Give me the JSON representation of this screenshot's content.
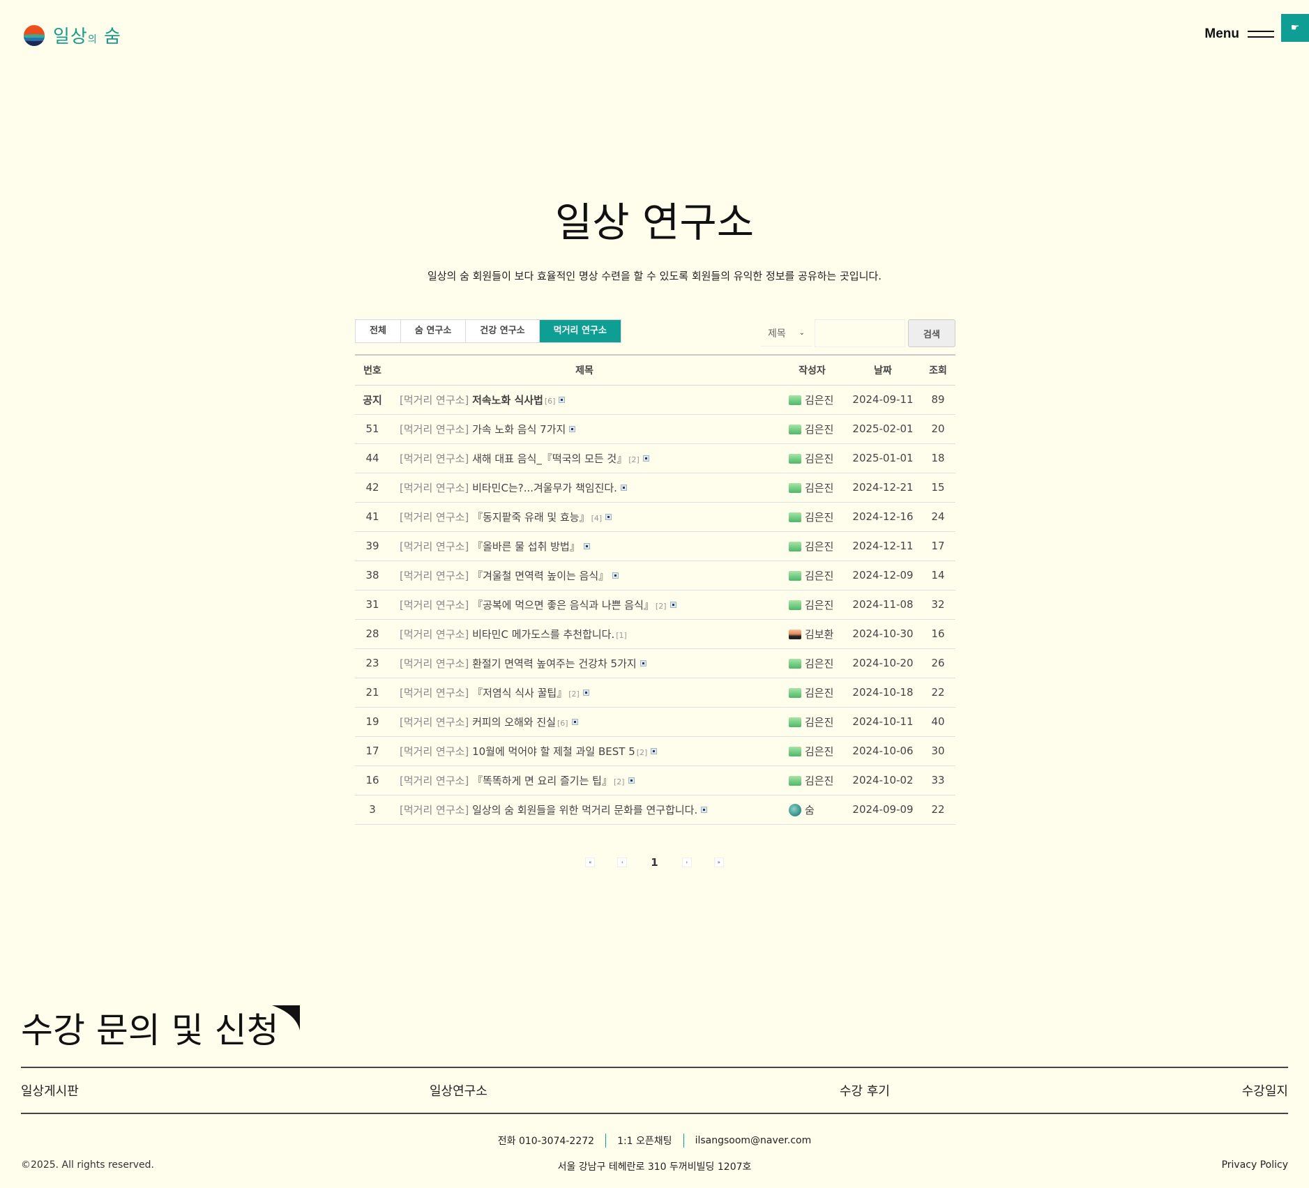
{
  "header": {
    "logo_main": "일상",
    "logo_small": "의",
    "logo_tail": " 숨",
    "menu_label": "Menu",
    "corner_icon": "hand-icon"
  },
  "page": {
    "title": "일상 연구소",
    "description": "일상의 숨 회원들이 보다 효율적인 명상 수련을 할 수 있도록 회원들의 유익한 정보를 공유하는 곳입니다."
  },
  "tabs": [
    {
      "label": "전체",
      "active": false
    },
    {
      "label": "숨 연구소",
      "active": false
    },
    {
      "label": "건강 연구소",
      "active": false
    },
    {
      "label": "먹거리 연구소",
      "active": true
    }
  ],
  "search": {
    "field_option": "제목",
    "input_value": "",
    "button_label": "검색"
  },
  "table": {
    "headers": {
      "num": "번호",
      "title": "제목",
      "author": "작성자",
      "date": "날짜",
      "views": "조회"
    },
    "rows": [
      {
        "num": "공지",
        "category": "[먹거리 연구소]",
        "title": "저속노화 식사법",
        "count": "[6]",
        "author": "김은진",
        "avatar": "green",
        "date": "2024-09-11",
        "views": "89"
      },
      {
        "num": "51",
        "category": "[먹거리 연구소]",
        "title": "가속 노화 음식 7가지",
        "count": "",
        "author": "김은진",
        "avatar": "green",
        "date": "2025-02-01",
        "views": "20"
      },
      {
        "num": "44",
        "category": "[먹거리 연구소]",
        "title": "새해 대표 음식_『떡국의 모든 것』",
        "count": "[2]",
        "author": "김은진",
        "avatar": "green",
        "date": "2025-01-01",
        "views": "18"
      },
      {
        "num": "42",
        "category": "[먹거리 연구소]",
        "title": "비타민C는?...겨울무가 책임진다.",
        "count": "",
        "author": "김은진",
        "avatar": "green",
        "date": "2024-12-21",
        "views": "15"
      },
      {
        "num": "41",
        "category": "[먹거리 연구소]",
        "title": "『동지팥죽 유래 및 효능』",
        "count": "[4]",
        "author": "김은진",
        "avatar": "green",
        "date": "2024-12-16",
        "views": "24"
      },
      {
        "num": "39",
        "category": "[먹거리 연구소]",
        "title": "『올바른 물 섭취 방법』",
        "count": "",
        "author": "김은진",
        "avatar": "green",
        "date": "2024-12-11",
        "views": "17"
      },
      {
        "num": "38",
        "category": "[먹거리 연구소]",
        "title": "『겨울철 면역력 높이는 음식』",
        "count": "",
        "author": "김은진",
        "avatar": "green",
        "date": "2024-12-09",
        "views": "14"
      },
      {
        "num": "31",
        "category": "[먹거리 연구소]",
        "title": "『공복에 먹으면 좋은 음식과 나쁜 음식』",
        "count": "[2]",
        "author": "김은진",
        "avatar": "green",
        "date": "2024-11-08",
        "views": "32"
      },
      {
        "num": "28",
        "category": "[먹거리 연구소]",
        "title": "비타민C 메가도스를 추천합니다.",
        "count": "[1]",
        "author": "김보환",
        "avatar": "sunset",
        "date": "2024-10-30",
        "views": "16",
        "no_image": true
      },
      {
        "num": "23",
        "category": "[먹거리 연구소]",
        "title": "환절기 면역력 높여주는 건강차 5가지",
        "count": "",
        "author": "김은진",
        "avatar": "green",
        "date": "2024-10-20",
        "views": "26"
      },
      {
        "num": "21",
        "category": "[먹거리 연구소]",
        "title": "『저염식 식사 꿀팁』",
        "count": "[2]",
        "author": "김은진",
        "avatar": "green",
        "date": "2024-10-18",
        "views": "22"
      },
      {
        "num": "19",
        "category": "[먹거리 연구소]",
        "title": "커피의 오해와 진실",
        "count": "[6]",
        "author": "김은진",
        "avatar": "green",
        "date": "2024-10-11",
        "views": "40"
      },
      {
        "num": "17",
        "category": "[먹거리 연구소]",
        "title": "10월에 먹어야 할 제철 과일 BEST 5",
        "count": "[2]",
        "author": "김은진",
        "avatar": "green",
        "date": "2024-10-06",
        "views": "30"
      },
      {
        "num": "16",
        "category": "[먹거리 연구소]",
        "title": "『똑똑하게 면 요리 즐기는 팁』",
        "count": "[2]",
        "author": "김은진",
        "avatar": "green",
        "date": "2024-10-02",
        "views": "33"
      },
      {
        "num": "3",
        "category": "[먹거리 연구소]",
        "title": "일상의 숨 회원들을 위한 먹거리 문화를 연구합니다.",
        "count": "",
        "author": "숨",
        "avatar": "globe",
        "date": "2024-09-09",
        "views": "22"
      }
    ]
  },
  "pagination": {
    "current": "1",
    "first": "«",
    "prev": "‹",
    "next": "›",
    "last": "»"
  },
  "footer": {
    "cta_title": "수강 문의 및 신청",
    "nav": [
      "일상게시판",
      "일상연구소",
      "수강 후기",
      "수강일지"
    ],
    "phone": "전화 010-3074-2272",
    "chat": "1:1 오픈채팅",
    "email": "ilsangsoom@naver.com",
    "address": "서울 강남구 테헤란로 310 두꺼비빌딩 1207호",
    "copyright": "©2025. All rights reserved.",
    "privacy": "Privacy Policy"
  },
  "colors": {
    "accent": "#0e9e93",
    "background": "#fffdeb",
    "logo_text": "#199b8c"
  }
}
